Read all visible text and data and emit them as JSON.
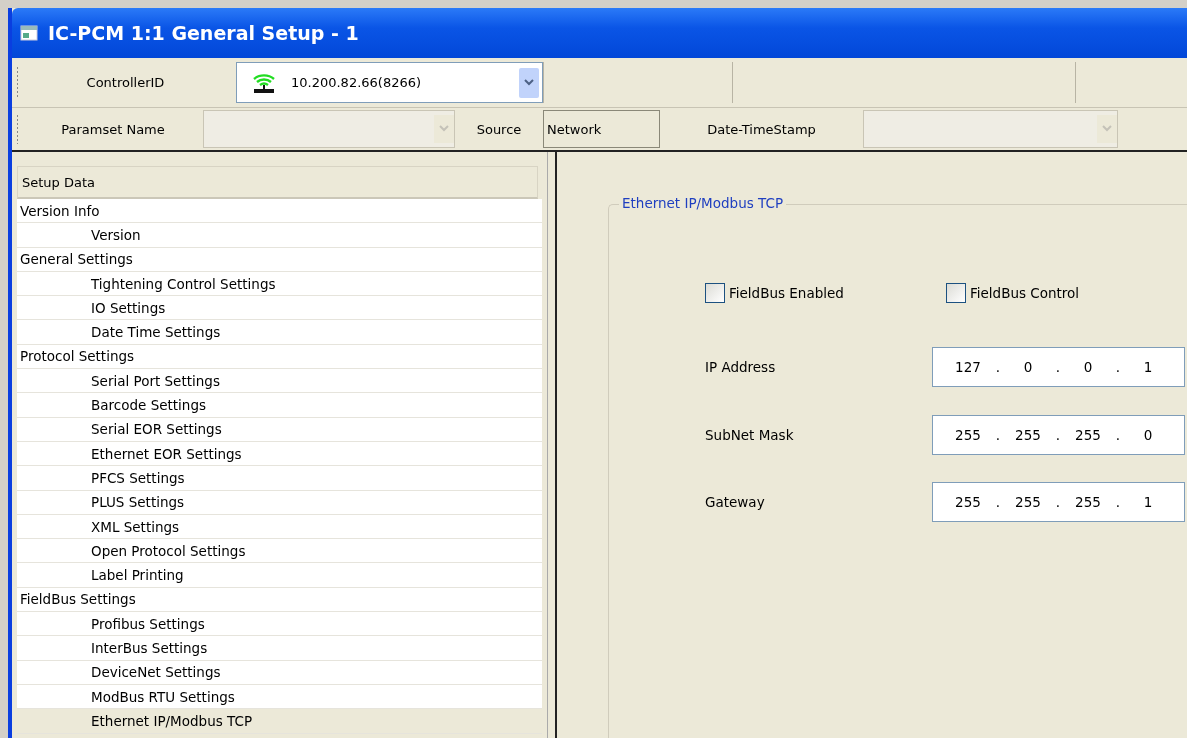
{
  "window": {
    "title": "IC-PCM 1:1 General Setup - 1"
  },
  "toolbar": {
    "controller_label": "ControllerID",
    "controller_value": "10.200.82.66(8266)",
    "paramset_label": "Paramset Name",
    "source_label": "Source",
    "source_value": "Network",
    "timestamp_label": "Date-TimeStamp"
  },
  "tree": {
    "header": "Setup Data",
    "items": [
      {
        "label": "Version Info",
        "selected": false,
        "children": [
          {
            "label": "Version",
            "selected": false
          }
        ]
      },
      {
        "label": "General Settings",
        "selected": false,
        "children": [
          {
            "label": "Tightening Control Settings",
            "selected": false
          },
          {
            "label": "IO Settings",
            "selected": false
          },
          {
            "label": "Date Time Settings",
            "selected": false
          }
        ]
      },
      {
        "label": "Protocol Settings",
        "selected": false,
        "children": [
          {
            "label": "Serial Port Settings",
            "selected": false
          },
          {
            "label": "Barcode Settings",
            "selected": false
          },
          {
            "label": "Serial EOR Settings",
            "selected": false
          },
          {
            "label": "Ethernet EOR Settings",
            "selected": false
          },
          {
            "label": "PFCS Settings",
            "selected": false
          },
          {
            "label": "PLUS Settings",
            "selected": false
          },
          {
            "label": "XML Settings",
            "selected": false
          },
          {
            "label": "Open Protocol Settings",
            "selected": false
          },
          {
            "label": "Label Printing",
            "selected": false
          }
        ]
      },
      {
        "label": "FieldBus Settings",
        "selected": false,
        "children": [
          {
            "label": "Profibus Settings",
            "selected": false
          },
          {
            "label": "InterBus Settings",
            "selected": false
          },
          {
            "label": "DeviceNet Settings",
            "selected": false
          },
          {
            "label": "ModBus RTU Settings",
            "selected": false
          },
          {
            "label": "Ethernet IP/Modbus TCP",
            "selected": true
          }
        ]
      }
    ]
  },
  "panel": {
    "title": "Ethernet IP/Modbus TCP",
    "checkboxes": [
      {
        "label": "FieldBus Enabled",
        "checked": false
      },
      {
        "label": "FieldBus Control",
        "checked": false
      }
    ],
    "fields": [
      {
        "label": "IP Address",
        "parts": [
          "127",
          ".",
          "0",
          ".",
          "0",
          ".",
          "1"
        ]
      },
      {
        "label": "SubNet Mask",
        "parts": [
          "255",
          ".",
          "255",
          ".",
          "255",
          ".",
          "0"
        ]
      },
      {
        "label": "Gateway",
        "parts": [
          "255",
          ".",
          "255",
          ".",
          "255",
          ".",
          "1"
        ]
      }
    ]
  }
}
